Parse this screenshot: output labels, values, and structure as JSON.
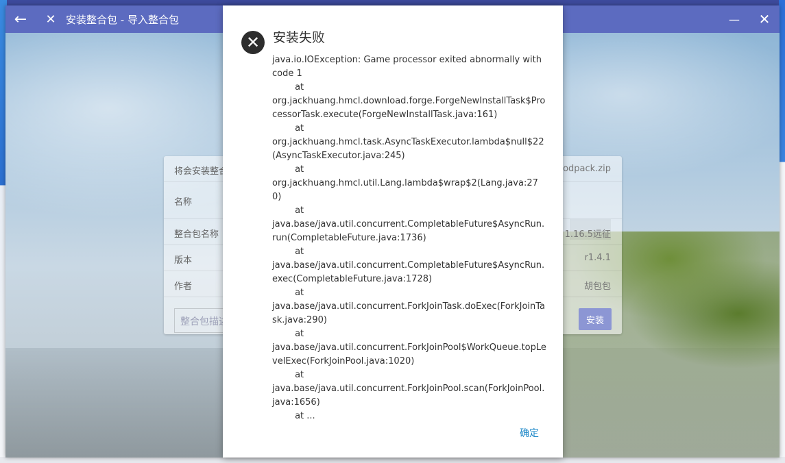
{
  "window": {
    "title": "安装整合包 - 导入整合包",
    "back_icon": "←",
    "close_icon": "✕",
    "minimize_icon": "—",
    "window_close_icon": "✕"
  },
  "card": {
    "header_text": "将会安装整合",
    "file_name": "modpack.zip",
    "name_label": "名称",
    "modpack_name_label": "整合包名称",
    "modpack_name_value": "1.16.5远征",
    "version_label": "版本",
    "version_value": "r1.4.1",
    "author_label": "作者",
    "author_value": "胡包包",
    "description_placeholder": "整合包描述",
    "install_label": "安装"
  },
  "dialog": {
    "icon": "✕",
    "title": "安装失败",
    "message": "java.io.IOException: Game processor exited abnormally with code 1\n\tat\norg.jackhuang.hmcl.download.forge.ForgeNewInstallTask$ProcessorTask.execute(ForgeNewInstallTask.java:161)\n\tat\norg.jackhuang.hmcl.task.AsyncTaskExecutor.lambda$null$22(AsyncTaskExecutor.java:245)\n\tat\norg.jackhuang.hmcl.util.Lang.lambda$wrap$2(Lang.java:270)\n\tat\njava.base/java.util.concurrent.CompletableFuture$AsyncRun.run(CompletableFuture.java:1736)\n\tat\njava.base/java.util.concurrent.CompletableFuture$AsyncRun.exec(CompletableFuture.java:1728)\n\tat\njava.base/java.util.concurrent.ForkJoinTask.doExec(ForkJoinTask.java:290)\n\tat\njava.base/java.util.concurrent.ForkJoinPool$WorkQueue.topLevelExec(ForkJoinPool.java:1020)\n\tat\njava.base/java.util.concurrent.ForkJoinPool.scan(ForkJoinPool.java:1656)\n\tat ...",
    "ok_label": "确定"
  },
  "colors": {
    "titlebar": "#5c6bc0",
    "accent": "#1e88c8",
    "error_icon": "#2d2d2d"
  }
}
